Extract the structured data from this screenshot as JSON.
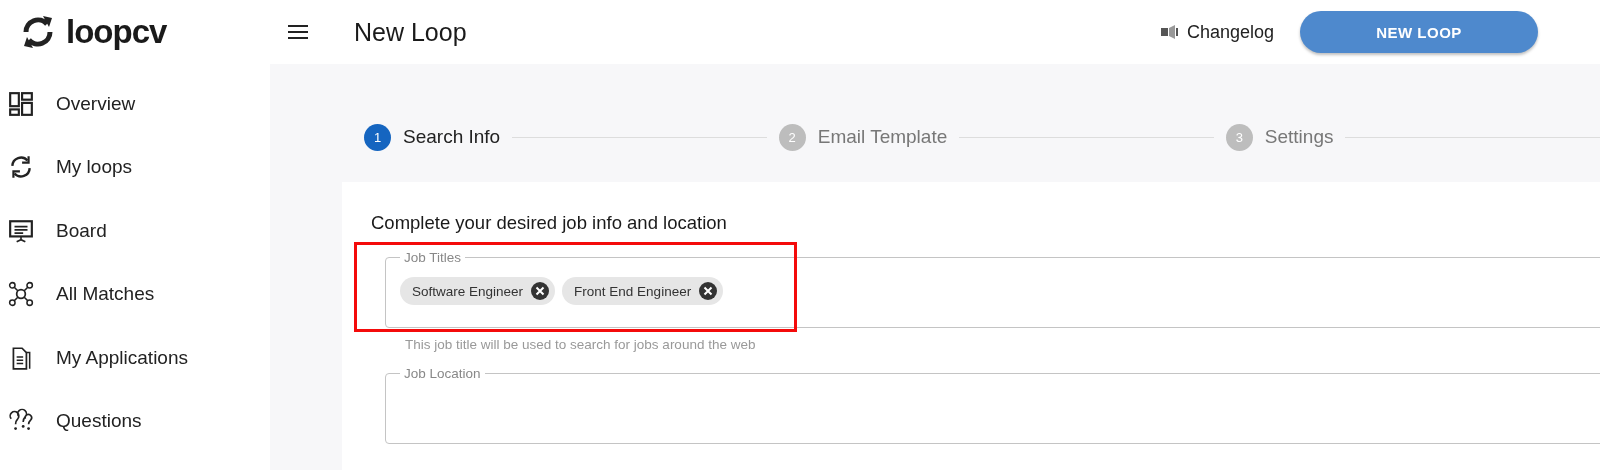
{
  "header": {
    "logo": "loopcv",
    "title": "New Loop",
    "changelog": "Changelog",
    "new_loop_button": "NEW LOOP"
  },
  "sidebar": {
    "items": [
      {
        "label": "Overview"
      },
      {
        "label": "My loops"
      },
      {
        "label": "Board"
      },
      {
        "label": "All Matches"
      },
      {
        "label": "My Applications"
      },
      {
        "label": "Questions"
      }
    ]
  },
  "stepper": [
    {
      "number": "1",
      "label": "Search Info",
      "selected": true
    },
    {
      "number": "2",
      "label": "Email Template",
      "selected": false
    },
    {
      "number": "3",
      "label": "Settings",
      "selected": false
    }
  ],
  "form": {
    "heading": "Complete your desired job info and location",
    "fields": [
      {
        "label": "Job Titles",
        "chips": [
          "Software Engineer",
          "Front End Engineer"
        ],
        "helper": "This job title will be used to search for jobs around the web",
        "highlighted": true
      },
      {
        "label": "Job Location",
        "highlighted": false
      }
    ]
  }
}
